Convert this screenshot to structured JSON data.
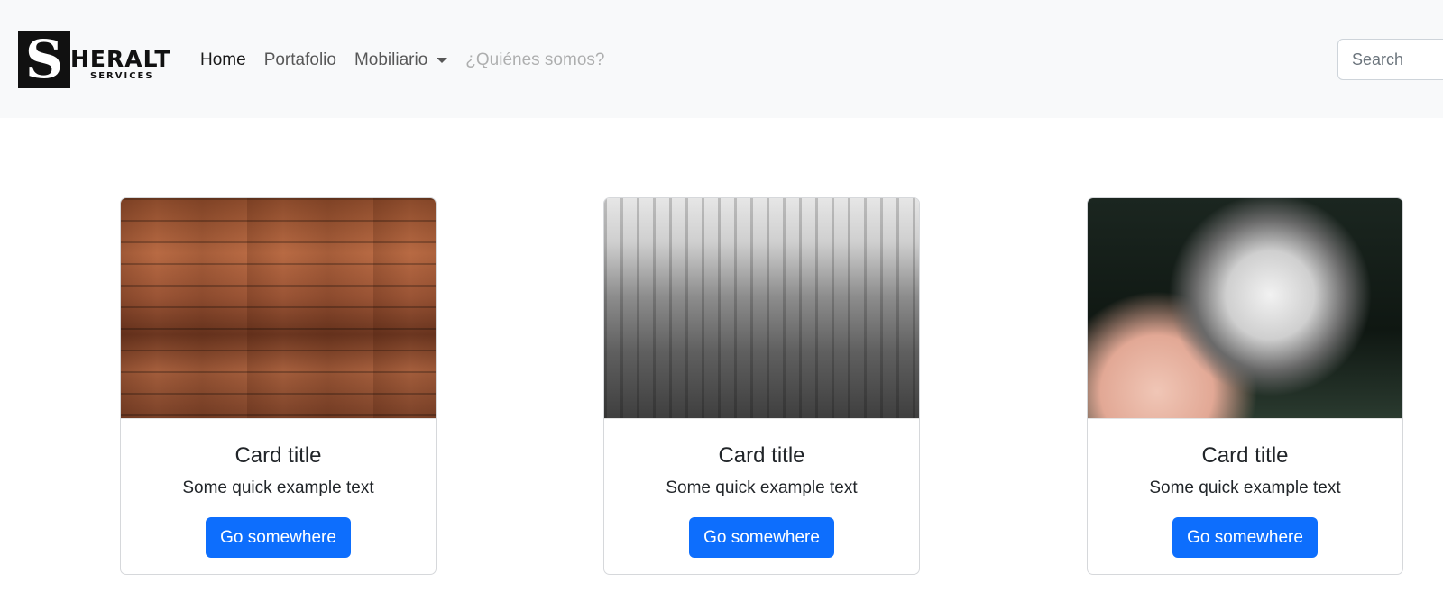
{
  "brand": {
    "letter": "S",
    "word": "HERALT",
    "sub": "SERVICES"
  },
  "nav": {
    "items": [
      {
        "label": "Home",
        "state": "active"
      },
      {
        "label": "Portafolio",
        "state": "normal"
      },
      {
        "label": "Mobiliario",
        "state": "dropdown"
      },
      {
        "label": "¿Quiénes somos?",
        "state": "disabled"
      }
    ]
  },
  "search": {
    "placeholder": "Search"
  },
  "cards": [
    {
      "image": "wood-planks-image",
      "title": "Card title",
      "text": "Some quick example text",
      "button": "Go somewhere"
    },
    {
      "image": "city-skyline-image",
      "title": "Card title",
      "text": "Some quick example text",
      "button": "Go somewhere"
    },
    {
      "image": "dandelion-image",
      "title": "Card title",
      "text": "Some quick example text",
      "button": "Go somewhere"
    }
  ],
  "colors": {
    "navbar_bg": "#f8f9fa",
    "primary": "#0d6efd"
  }
}
